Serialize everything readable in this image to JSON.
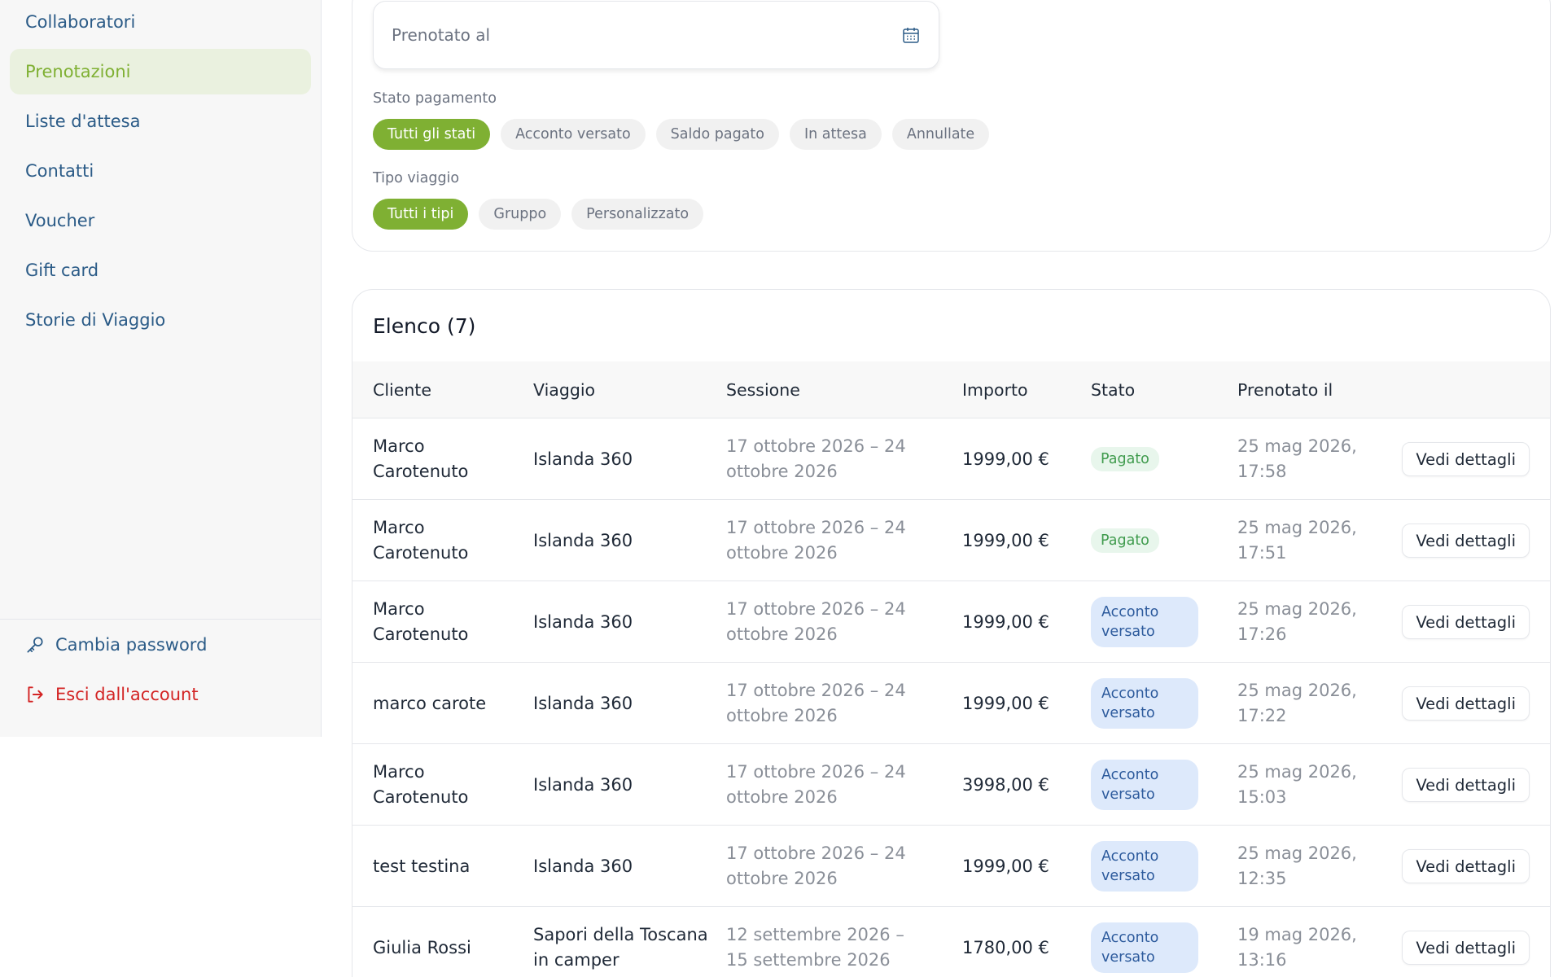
{
  "sidebar": {
    "items": [
      {
        "label": "Collaboratori"
      },
      {
        "label": "Prenotazioni",
        "active": true
      },
      {
        "label": "Liste d'attesa"
      },
      {
        "label": "Contatti"
      },
      {
        "label": "Voucher"
      },
      {
        "label": "Gift card"
      },
      {
        "label": "Storie di Viaggio"
      }
    ],
    "change_password": "Cambia password",
    "logout": "Esci dall'account"
  },
  "filters": {
    "booked_on_placeholder": "Prenotato al",
    "payment_status_label": "Stato pagamento",
    "payment_chips": [
      "Tutti gli stati",
      "Acconto versato",
      "Saldo pagato",
      "In attesa",
      "Annullate"
    ],
    "trip_type_label": "Tipo viaggio",
    "trip_chips": [
      "Tutti i tipi",
      "Gruppo",
      "Personalizzato"
    ]
  },
  "list": {
    "title": "Elenco (7)",
    "columns": [
      "Cliente",
      "Viaggio",
      "Sessione",
      "Importo",
      "Stato",
      "Prenotato il"
    ],
    "detail_button": "Vedi dettagli",
    "rows": [
      {
        "client": "Marco Carotenuto",
        "trip": "Islanda 360",
        "session": "17 ottobre 2026 – 24 ottobre 2026",
        "amount": "1999,00 €",
        "status": "Pagato",
        "status_type": "pagato",
        "booked": "25 mag 2026, 17:58"
      },
      {
        "client": "Marco Carotenuto",
        "trip": "Islanda 360",
        "session": "17 ottobre 2026 – 24 ottobre 2026",
        "amount": "1999,00 €",
        "status": "Pagato",
        "status_type": "pagato",
        "booked": "25 mag 2026, 17:51"
      },
      {
        "client": "Marco Carotenuto",
        "trip": "Islanda 360",
        "session": "17 ottobre 2026 – 24 ottobre 2026",
        "amount": "1999,00 €",
        "status": "Acconto versato",
        "status_type": "acconto",
        "booked": "25 mag 2026, 17:26"
      },
      {
        "client": "marco carote",
        "trip": "Islanda 360",
        "session": "17 ottobre 2026 – 24 ottobre 2026",
        "amount": "1999,00 €",
        "status": "Acconto versato",
        "status_type": "acconto",
        "booked": "25 mag 2026, 17:22"
      },
      {
        "client": "Marco Carotenuto",
        "trip": "Islanda 360",
        "session": "17 ottobre 2026 – 24 ottobre 2026",
        "amount": "3998,00 €",
        "status": "Acconto versato",
        "status_type": "acconto",
        "booked": "25 mag 2026, 15:03"
      },
      {
        "client": "test testina",
        "trip": "Islanda 360",
        "session": "17 ottobre 2026 – 24 ottobre 2026",
        "amount": "1999,00 €",
        "status": "Acconto versato",
        "status_type": "acconto",
        "booked": "25 mag 2026, 12:35"
      },
      {
        "client": "Giulia Rossi",
        "trip": "Sapori della Toscana in camper",
        "session": "12 settembre 2026 – 15 settembre 2026",
        "amount": "1780,00 €",
        "status": "Acconto versato",
        "status_type": "acconto",
        "booked": "19 mag 2026, 13:16"
      }
    ]
  },
  "colors": {
    "accent_green": "#7fb033",
    "nav_blue": "#2b5b87",
    "logout_red": "#d32424",
    "badge_paid_bg": "#e8f6ec",
    "badge_deposit_bg": "#dde9fb"
  },
  "icons": {
    "calendar": "calendar-icon",
    "key": "key-icon",
    "logout": "logout-icon"
  }
}
